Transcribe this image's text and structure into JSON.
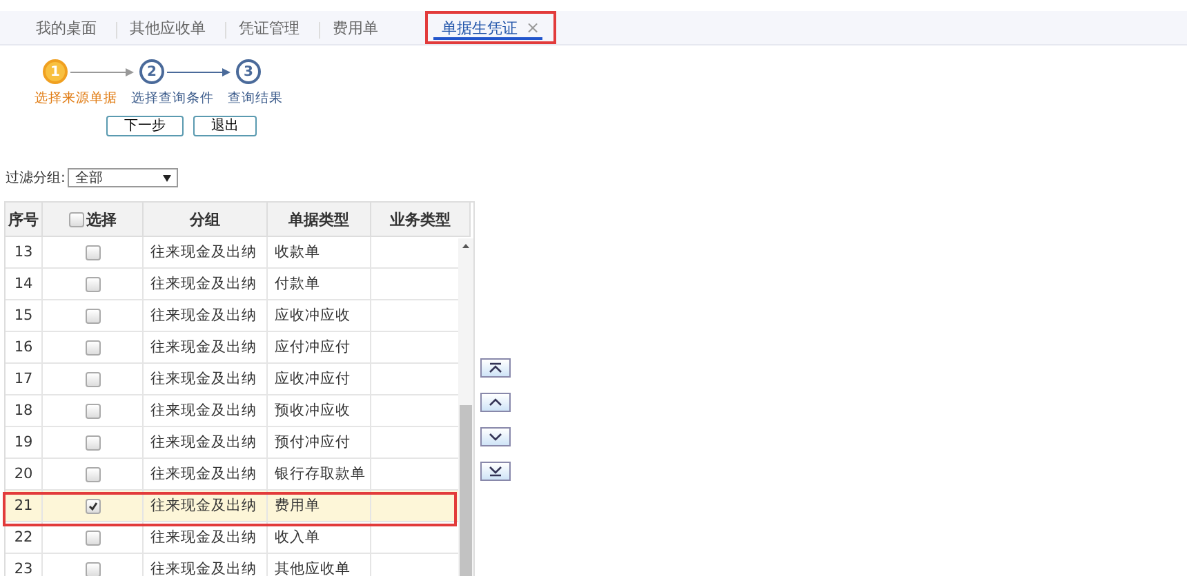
{
  "tabs": [
    {
      "label": "我的桌面",
      "selected": false,
      "closable": false
    },
    {
      "label": "其他应收单",
      "selected": false,
      "closable": false
    },
    {
      "label": "凭证管理",
      "selected": false,
      "closable": false
    },
    {
      "label": "费用单",
      "selected": false,
      "closable": false
    },
    {
      "label": "单据生凭证",
      "selected": true,
      "closable": true,
      "close": "×"
    }
  ],
  "steps": [
    {
      "number": "1",
      "label": "选择来源单据",
      "selected": true
    },
    {
      "number": "2",
      "label": "选择查询条件",
      "selected": false
    },
    {
      "number": "3",
      "label": "查询结果",
      "selected": false
    }
  ],
  "buttons": [
    "下一步",
    "退出"
  ],
  "filter": {
    "label": "过滤分组:",
    "value": "全部"
  },
  "table": {
    "columns": [
      "序号",
      "选择",
      "分组",
      "单据类型",
      "业务类型"
    ],
    "select_all": false,
    "rows": [
      {
        "no": "13",
        "checked": false,
        "group": "往来现金及出纳",
        "type": "收款单",
        "selected": false
      },
      {
        "no": "14",
        "checked": false,
        "group": "往来现金及出纳",
        "type": "付款单",
        "selected": false
      },
      {
        "no": "15",
        "checked": false,
        "group": "往来现金及出纳",
        "type": "应收冲应收",
        "selected": false
      },
      {
        "no": "16",
        "checked": false,
        "group": "往来现金及出纳",
        "type": "应付冲应付",
        "selected": false
      },
      {
        "no": "17",
        "checked": false,
        "group": "往来现金及出纳",
        "type": "应收冲应付",
        "selected": false
      },
      {
        "no": "18",
        "checked": false,
        "group": "往来现金及出纳",
        "type": "预收冲应收",
        "selected": false
      },
      {
        "no": "19",
        "checked": false,
        "group": "往来现金及出纳",
        "type": "预付冲应付",
        "selected": false
      },
      {
        "no": "20",
        "checked": false,
        "group": "往来现金及出纳",
        "type": "银行存取款单",
        "selected": false
      },
      {
        "no": "21",
        "checked": true,
        "group": "往来现金及出纳",
        "type": "费用单",
        "selected": true
      },
      {
        "no": "22",
        "checked": false,
        "group": "往来现金及出纳",
        "type": "收入单",
        "selected": false
      },
      {
        "no": "23",
        "checked": false,
        "group": "往来现金及出纳",
        "type": "其他应收单",
        "selected": false
      }
    ]
  },
  "move_buttons": [
    {
      "kind": "top"
    },
    {
      "kind": "up"
    },
    {
      "kind": "down"
    },
    {
      "kind": "bottom"
    }
  ]
}
